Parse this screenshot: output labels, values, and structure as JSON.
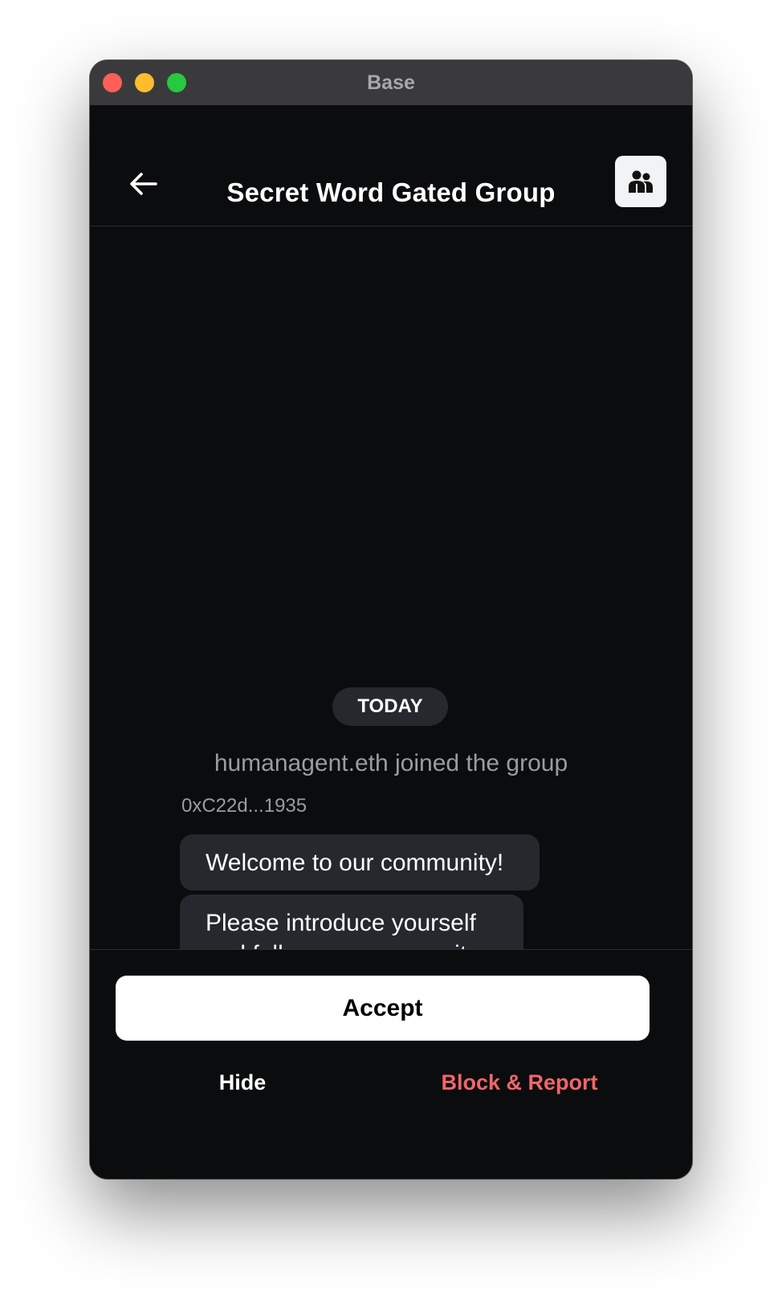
{
  "window": {
    "title": "Base"
  },
  "header": {
    "title": "Secret Word Gated Group",
    "back_icon": "arrow-left-icon",
    "members_icon": "people-icon"
  },
  "chat": {
    "date_divider": "TODAY",
    "system_message": "humanagent.eth joined the group",
    "sender": "0xC22d...1935",
    "messages": [
      "Welcome to our community!",
      "Please introduce yourself and follow our community guidelines."
    ]
  },
  "actions": {
    "accept": "Accept",
    "hide": "Hide",
    "block_report": "Block & Report"
  },
  "colors": {
    "background": "#0b0c0e",
    "bubble": "#26282e",
    "danger": "#f2656a"
  }
}
